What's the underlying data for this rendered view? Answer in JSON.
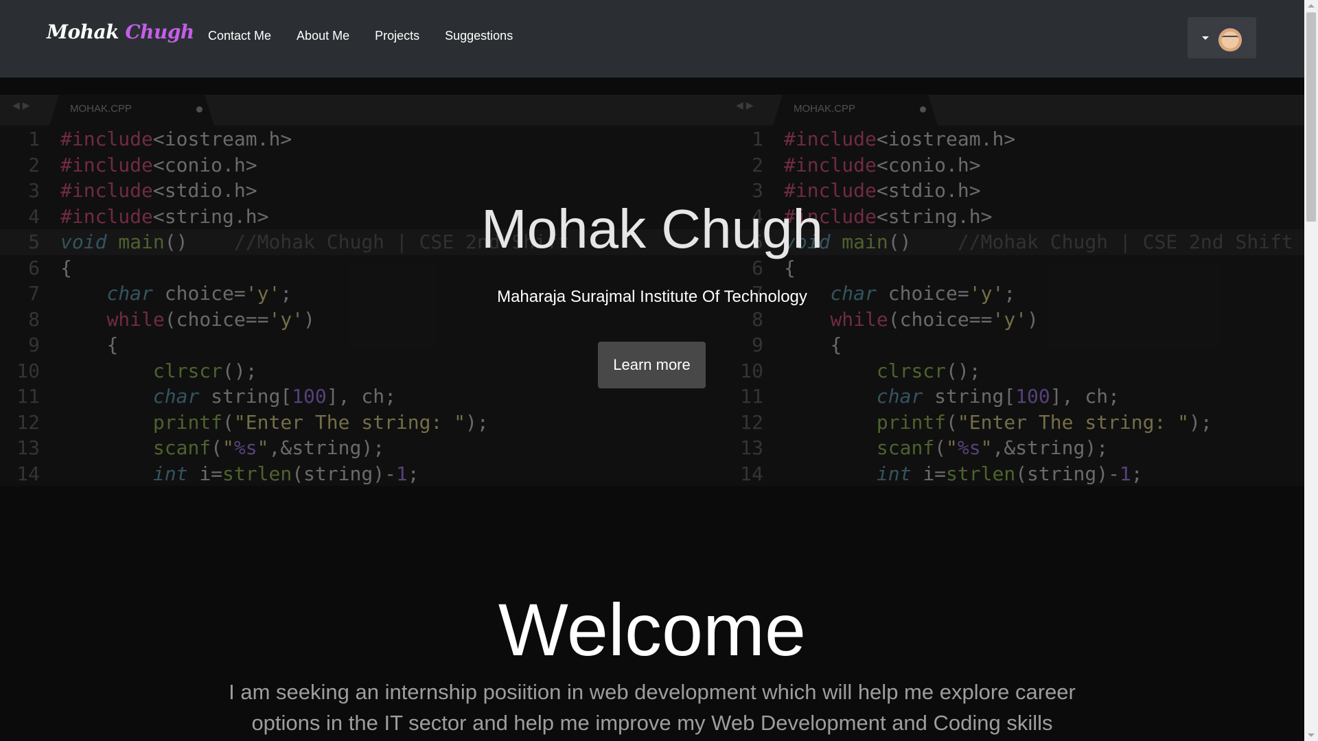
{
  "nav": {
    "brand_first": "Mohak",
    "brand_last": "Chugh",
    "links": [
      "Contact Me",
      "About Me",
      "Projects",
      "Suggestions"
    ]
  },
  "hero": {
    "title": "Mohak Chugh",
    "subtitle": "Maharaja Surajmal Institute Of Technology",
    "button": "Learn more"
  },
  "editor": {
    "tab_name": "MOHAK.CPP",
    "line_numbers": [
      "1",
      "2",
      "3",
      "4",
      "5",
      "6",
      "7",
      "8",
      "9",
      "10",
      "11",
      "12",
      "13",
      "14"
    ],
    "lines": [
      "#include<iostream.h>",
      "#include<conio.h>",
      "#include<stdio.h>",
      "#include<string.h>",
      "void main()    //Mohak Chugh | CSE 2nd Shift",
      "{",
      "    char choice='y';",
      "    while(choice=='y')",
      "    {",
      "        clrscr();",
      "        char string[100], ch;",
      "        printf(\"Enter The string: \");",
      "        scanf(\"%s\",&string);",
      "        int i=strlen(string)-1;"
    ]
  },
  "welcome": {
    "title": "Welcome",
    "text": "I am seeking an internship posiition in web development which will help me explore career options in the IT sector and help me improve my Web Development and Coding skills"
  },
  "colors": {
    "navbar": "#2b2f33",
    "brand_accent": "#c55ee8",
    "keyword": "#c24a73",
    "type": "#5b8fa4",
    "function": "#86a94f",
    "string": "#c9bd7a",
    "number": "#9670d2"
  },
  "icons": [
    "caret-down-icon",
    "user-avatar"
  ]
}
